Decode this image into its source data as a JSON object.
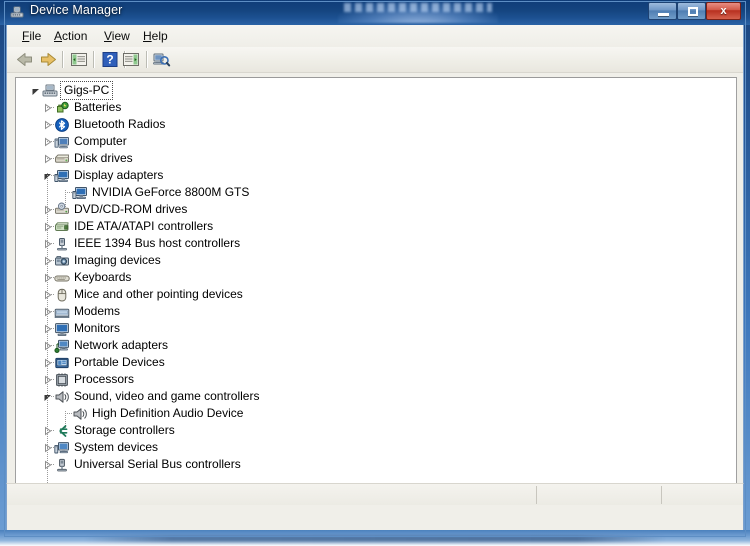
{
  "window": {
    "title": "Device Manager",
    "title_icon": "device-manager-icon",
    "minimize_label": "Minimize",
    "maximize_label": "Maximize",
    "close_label": "Close",
    "close_glyph": "x"
  },
  "menu": {
    "items": [
      {
        "label": "File",
        "accel": "F",
        "name": "menu-file"
      },
      {
        "label": "Action",
        "accel": "A",
        "name": "menu-action"
      },
      {
        "label": "View",
        "accel": "V",
        "name": "menu-view"
      },
      {
        "label": "Help",
        "accel": "H",
        "name": "menu-help"
      }
    ]
  },
  "toolbar": {
    "buttons": [
      {
        "icon": "back-arrow-icon",
        "tooltip": "Back"
      },
      {
        "icon": "forward-arrow-icon",
        "tooltip": "Forward"
      },
      {
        "icon": "show-console-tree-icon",
        "tooltip": "Show/Hide Console Tree"
      },
      {
        "icon": "help-icon",
        "tooltip": "Help"
      },
      {
        "icon": "properties-icon",
        "tooltip": "Properties"
      },
      {
        "icon": "scan-for-hardware-changes-icon",
        "tooltip": "Scan for hardware changes"
      }
    ]
  },
  "tree": {
    "root": {
      "label": "Gigs-PC",
      "icon": "computer-root-icon",
      "expanded": true,
      "selected": true
    },
    "nodes": [
      {
        "label": "Batteries",
        "icon": "battery-icon",
        "expanded": false,
        "level": 1
      },
      {
        "label": "Bluetooth Radios",
        "icon": "bluetooth-icon",
        "expanded": false,
        "level": 1
      },
      {
        "label": "Computer",
        "icon": "computer-icon",
        "expanded": false,
        "level": 1
      },
      {
        "label": "Disk drives",
        "icon": "disk-drive-icon",
        "expanded": false,
        "level": 1
      },
      {
        "label": "Display adapters",
        "icon": "display-icon",
        "expanded": true,
        "level": 1
      },
      {
        "label": "NVIDIA GeForce 8800M GTS",
        "icon": "display-icon",
        "expanded": null,
        "level": 2
      },
      {
        "label": "DVD/CD-ROM drives",
        "icon": "dvd-drive-icon",
        "expanded": false,
        "level": 1
      },
      {
        "label": "IDE ATA/ATAPI controllers",
        "icon": "ide-controller-icon",
        "expanded": false,
        "level": 1
      },
      {
        "label": "IEEE 1394 Bus host controllers",
        "icon": "ieee1394-icon",
        "expanded": false,
        "level": 1
      },
      {
        "label": "Imaging devices",
        "icon": "camera-icon",
        "expanded": false,
        "level": 1
      },
      {
        "label": "Keyboards",
        "icon": "keyboard-icon",
        "expanded": false,
        "level": 1
      },
      {
        "label": "Mice and other pointing devices",
        "icon": "mouse-icon",
        "expanded": false,
        "level": 1
      },
      {
        "label": "Modems",
        "icon": "modem-icon",
        "expanded": false,
        "level": 1
      },
      {
        "label": "Monitors",
        "icon": "monitor-icon",
        "expanded": false,
        "level": 1
      },
      {
        "label": "Network adapters",
        "icon": "network-adapter-icon",
        "expanded": false,
        "level": 1
      },
      {
        "label": "Portable Devices",
        "icon": "portable-device-icon",
        "expanded": false,
        "level": 1
      },
      {
        "label": "Processors",
        "icon": "processor-icon",
        "expanded": false,
        "level": 1
      },
      {
        "label": "Sound, video and game controllers",
        "icon": "speaker-icon",
        "expanded": true,
        "level": 1
      },
      {
        "label": "High Definition Audio Device",
        "icon": "speaker-icon",
        "expanded": null,
        "level": 2
      },
      {
        "label": "Storage controllers",
        "icon": "storage-controller-icon",
        "expanded": false,
        "level": 1
      },
      {
        "label": "System devices",
        "icon": "system-device-icon",
        "expanded": false,
        "level": 1
      },
      {
        "label": "Universal Serial Bus controllers",
        "icon": "usb-icon",
        "expanded": false,
        "level": 1
      }
    ]
  },
  "status_bar": {
    "cells": [
      "",
      "",
      ""
    ]
  },
  "colors": {
    "title_bar": "#14447f",
    "close_button": "#b83020",
    "panel_background": "#ffffff",
    "chrome_background": "#f0efe9",
    "frame_blue": "#3f79bd"
  }
}
